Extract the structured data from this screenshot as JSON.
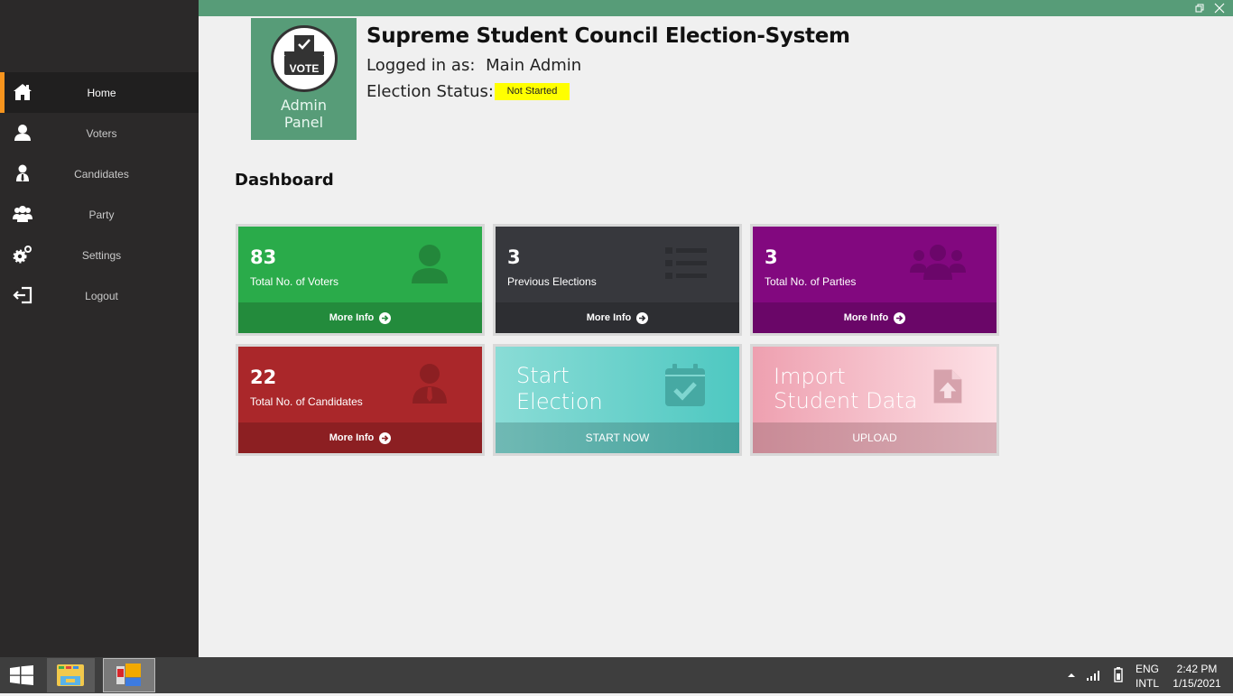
{
  "window": {
    "restore_icon": "restore-icon",
    "close_icon": "close-icon"
  },
  "sidebar": {
    "items": [
      {
        "label": "Home",
        "icon": "home-icon",
        "active": true
      },
      {
        "label": "Voters",
        "icon": "user-icon",
        "active": false
      },
      {
        "label": "Candidates",
        "icon": "candidate-icon",
        "active": false
      },
      {
        "label": "Party",
        "icon": "group-icon",
        "active": false
      },
      {
        "label": "Settings",
        "icon": "gears-icon",
        "active": false
      },
      {
        "label": "Logout",
        "icon": "logout-icon",
        "active": false
      }
    ]
  },
  "header": {
    "logo_badge": "VOTE",
    "logo_line1": "Admin",
    "logo_line2": "Panel",
    "title": "Supreme Student Council Election-System",
    "logged_in_label": "Logged in as:",
    "logged_in_user": "Main Admin",
    "status_label": "Election Status:",
    "status_value": "Not Started",
    "colors": {
      "brand": "#579c78",
      "status_badge": "#ffff00"
    }
  },
  "dashboard": {
    "title": "Dashboard",
    "cards": [
      {
        "count": "83",
        "label": "Total No. of Voters",
        "footer": "More Info",
        "icon": "user-icon",
        "color": "#2aab4a",
        "footer_color": "#238b3c"
      },
      {
        "count": "3",
        "label": "Previous Elections",
        "footer": "More Info",
        "icon": "list-icon",
        "color": "#37383d",
        "footer_color": "#2d2e32"
      },
      {
        "count": "3",
        "label": "Total No. of Parties",
        "footer": "More Info",
        "icon": "group-icon",
        "color": "#82087f",
        "footer_color": "#6a0668"
      },
      {
        "count": "22",
        "label": "Total No. of Candidates",
        "footer": "More Info",
        "icon": "candidate-icon",
        "color": "#aa272a",
        "footer_color": "#8c1f22"
      }
    ],
    "actions": [
      {
        "line1": "Start",
        "line2": "Election",
        "footer": "START NOW",
        "icon": "calendar-check-icon"
      },
      {
        "line1": "Import",
        "line2": "Student Data",
        "footer": "UPLOAD",
        "icon": "file-upload-icon"
      }
    ]
  },
  "taskbar": {
    "start_icon": "windows-start-icon",
    "apps": [
      "file-explorer-icon",
      "election-app-icon"
    ],
    "tray": {
      "lang_line1": "ENG",
      "lang_line2": "INTL",
      "time": "2:42 PM",
      "date": "1/15/2021"
    }
  }
}
